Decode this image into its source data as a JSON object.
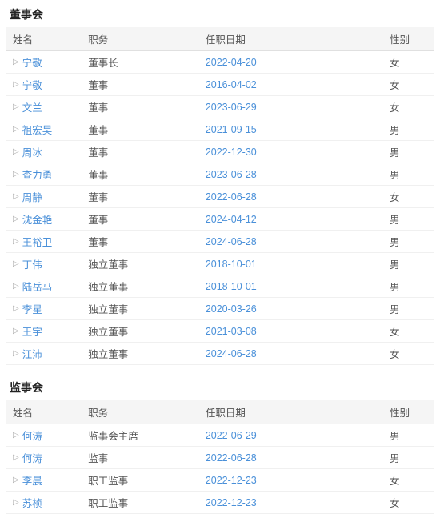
{
  "board": {
    "title": "董事会",
    "headers": {
      "name": "姓名",
      "position": "职务",
      "date": "任职日期",
      "gender": "性别"
    },
    "rows": [
      {
        "name": "宁敬",
        "position": "董事长",
        "date": "2022-04-20",
        "gender": "女"
      },
      {
        "name": "宁敬",
        "position": "董事",
        "date": "2016-04-02",
        "gender": "女"
      },
      {
        "name": "文兰",
        "position": "董事",
        "date": "2023-06-29",
        "gender": "女"
      },
      {
        "name": "祖宏昊",
        "position": "董事",
        "date": "2021-09-15",
        "gender": "男"
      },
      {
        "name": "周冰",
        "position": "董事",
        "date": "2022-12-30",
        "gender": "男"
      },
      {
        "name": "查力勇",
        "position": "董事",
        "date": "2023-06-28",
        "gender": "男"
      },
      {
        "name": "周静",
        "position": "董事",
        "date": "2022-06-28",
        "gender": "女"
      },
      {
        "name": "沈金艳",
        "position": "董事",
        "date": "2024-04-12",
        "gender": "男"
      },
      {
        "name": "王裕卫",
        "position": "董事",
        "date": "2024-06-28",
        "gender": "男"
      },
      {
        "name": "丁伟",
        "position": "独立董事",
        "date": "2018-10-01",
        "gender": "男"
      },
      {
        "name": "陆岳马",
        "position": "独立董事",
        "date": "2018-10-01",
        "gender": "男"
      },
      {
        "name": "李星",
        "position": "独立董事",
        "date": "2020-03-26",
        "gender": "男"
      },
      {
        "name": "王宇",
        "position": "独立董事",
        "date": "2021-03-08",
        "gender": "女"
      },
      {
        "name": "江沛",
        "position": "独立董事",
        "date": "2024-06-28",
        "gender": "女"
      }
    ]
  },
  "supervisory": {
    "title": "监事会",
    "headers": {
      "name": "姓名",
      "position": "职务",
      "date": "任职日期",
      "gender": "性别"
    },
    "rows": [
      {
        "name": "何涛",
        "position": "监事会主席",
        "date": "2022-06-29",
        "gender": "男"
      },
      {
        "name": "何涛",
        "position": "监事",
        "date": "2022-06-28",
        "gender": "男"
      },
      {
        "name": "李晨",
        "position": "职工监事",
        "date": "2022-12-23",
        "gender": "女"
      },
      {
        "name": "苏桢",
        "position": "职工监事",
        "date": "2022-12-23",
        "gender": "女"
      }
    ]
  }
}
